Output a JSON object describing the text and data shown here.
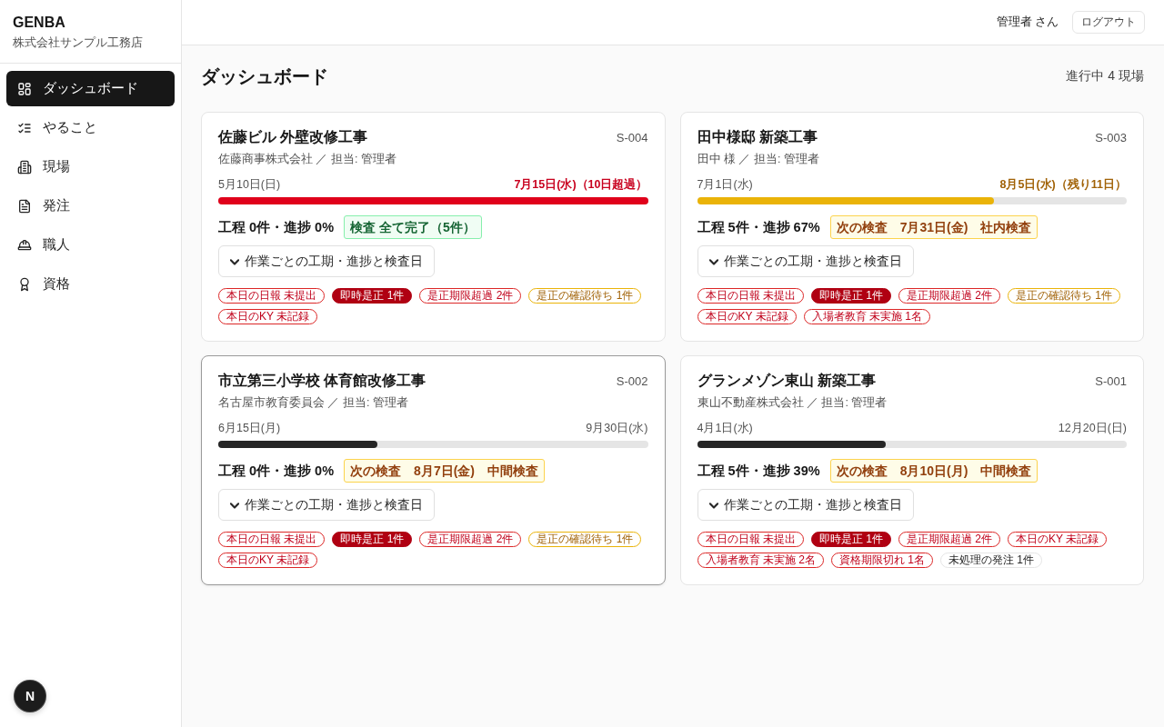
{
  "sidebar": {
    "brand": "GENBA",
    "company": "株式会社サンプル工務店",
    "items": [
      {
        "label": "ダッシュボード",
        "selected": true
      },
      {
        "label": "やること",
        "selected": false
      },
      {
        "label": "現場",
        "selected": false
      },
      {
        "label": "発注",
        "selected": false
      },
      {
        "label": "職人",
        "selected": false
      },
      {
        "label": "資格",
        "selected": false
      }
    ],
    "dev_indicator": "N"
  },
  "topbar": {
    "user": "管理者 さん",
    "logout": "ログアウト"
  },
  "page": {
    "title": "ダッシュボード",
    "summary": "進行中 4 現場"
  },
  "sites": [
    {
      "name": "佐藤ビル 外壁改修工事",
      "code": "S-004",
      "client": "佐藤商事株式会社 ／ 担当: 管理者",
      "start": "5月10日(日)",
      "end": {
        "kind": "overdue",
        "text": "7月15日(水)（10日超過）"
      },
      "level": 1,
      "stats": "工程 0件・進捗 0%",
      "inspection": {
        "kind": "done",
        "text": "検査 全て完了（5件）"
      },
      "details_button": "作業ごとの工期・進捗と検査日",
      "highlighted": false,
      "alerts": [
        {
          "kind": "danger",
          "label": "本日の日報 未提出"
        },
        {
          "kind": "critical",
          "label": "即時是正 1件"
        },
        {
          "kind": "danger",
          "label": "是正期限超過 2件"
        },
        {
          "kind": "warning",
          "label": "是正の確認待ち 1件"
        },
        {
          "kind": "danger",
          "label": "本日のKY 未記録"
        }
      ]
    },
    {
      "name": "田中様邸 新築工事",
      "code": "S-003",
      "client": "田中 様 ／ 担当: 管理者",
      "start": "7月1日(水)",
      "end": {
        "kind": "soon",
        "text": "8月5日(水)（残り11日）"
      },
      "level": 0.69,
      "stats": "工程 5件・進捗 67%",
      "inspection": {
        "kind": "upcoming",
        "text": "次の検査　7月31日(金)　社内検査"
      },
      "details_button": "作業ごとの工期・進捗と検査日",
      "highlighted": false,
      "alerts": [
        {
          "kind": "danger",
          "label": "本日の日報 未提出"
        },
        {
          "kind": "critical",
          "label": "即時是正 1件"
        },
        {
          "kind": "danger",
          "label": "是正期限超過 2件"
        },
        {
          "kind": "warning",
          "label": "是正の確認待ち 1件"
        },
        {
          "kind": "danger",
          "label": "本日のKY 未記録"
        },
        {
          "kind": "danger",
          "label": "入場者教育 未実施 1名"
        }
      ]
    },
    {
      "name": "市立第三小学校 体育館改修工事",
      "code": "S-002",
      "client": "名古屋市教育委員会 ／ 担当: 管理者",
      "start": "6月15日(月)",
      "end": {
        "kind": "normal",
        "text": "9月30日(水)"
      },
      "level": 0.37,
      "stats": "工程 0件・進捗 0%",
      "inspection": {
        "kind": "upcoming",
        "text": "次の検査　8月7日(金)　中間検査"
      },
      "details_button": "作業ごとの工期・進捗と検査日",
      "highlighted": true,
      "alerts": [
        {
          "kind": "danger",
          "label": "本日の日報 未提出"
        },
        {
          "kind": "critical",
          "label": "即時是正 1件"
        },
        {
          "kind": "danger",
          "label": "是正期限超過 2件"
        },
        {
          "kind": "warning",
          "label": "是正の確認待ち 1件"
        },
        {
          "kind": "danger",
          "label": "本日のKY 未記録"
        }
      ]
    },
    {
      "name": "グランメゾン東山 新築工事",
      "code": "S-001",
      "client": "東山不動産株式会社 ／ 担当: 管理者",
      "start": "4月1日(水)",
      "end": {
        "kind": "normal",
        "text": "12月20日(日)"
      },
      "level": 0.44,
      "stats": "工程 5件・進捗 39%",
      "inspection": {
        "kind": "upcoming",
        "text": "次の検査　8月10日(月)　中間検査"
      },
      "details_button": "作業ごとの工期・進捗と検査日",
      "highlighted": false,
      "alerts": [
        {
          "kind": "danger",
          "label": "本日の日報 未提出"
        },
        {
          "kind": "critical",
          "label": "即時是正 1件"
        },
        {
          "kind": "danger",
          "label": "是正期限超過 2件"
        },
        {
          "kind": "danger",
          "label": "本日のKY 未記録"
        },
        {
          "kind": "danger",
          "label": "入場者教育 未実施 2名"
        },
        {
          "kind": "danger",
          "label": "資格期限切れ 1名"
        },
        {
          "kind": "neutral",
          "label": "未処理の発注 1件"
        }
      ]
    }
  ]
}
